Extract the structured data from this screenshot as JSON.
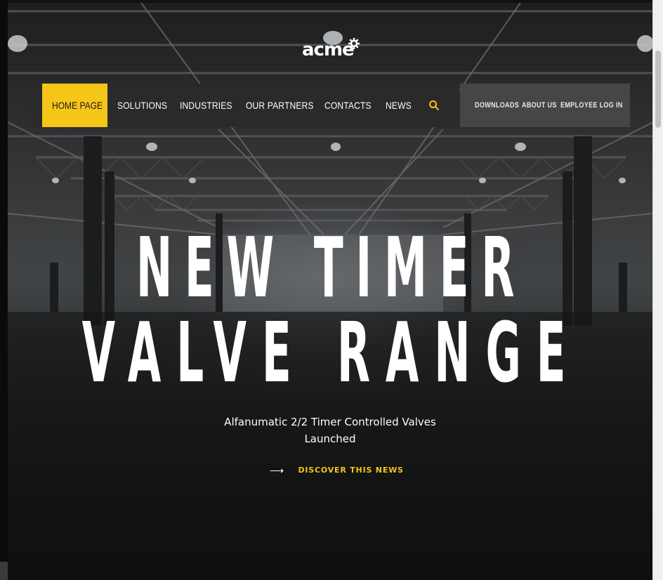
{
  "brand": {
    "logo_text": "acme",
    "logo_icon": "gear-icon",
    "accent_color": "#f5c518"
  },
  "nav": {
    "items": [
      {
        "label": "HOME PAGE",
        "active": true
      },
      {
        "label": "SOLUTIONS",
        "active": false
      },
      {
        "label": "INDUSTRIES",
        "active": false
      },
      {
        "label": "OUR PARTNERS",
        "active": false
      },
      {
        "label": "CONTACTS",
        "active": false
      },
      {
        "label": "NEWS",
        "active": false
      }
    ],
    "search_icon": "search-icon",
    "utility": [
      {
        "label": "DOWNLOADS"
      },
      {
        "label": "ABOUT US"
      },
      {
        "label": "EMPLOYEE LOG IN"
      }
    ]
  },
  "hero": {
    "headline_line1": "NEW TIMER",
    "headline_line2": "VALVE RANGE",
    "subtitle_line1": "Alfanumatic 2/2 Timer Controlled Valves",
    "subtitle_line2": "Launched",
    "cta_arrow": "⟶",
    "cta_label": "DISCOVER THIS NEWS"
  }
}
